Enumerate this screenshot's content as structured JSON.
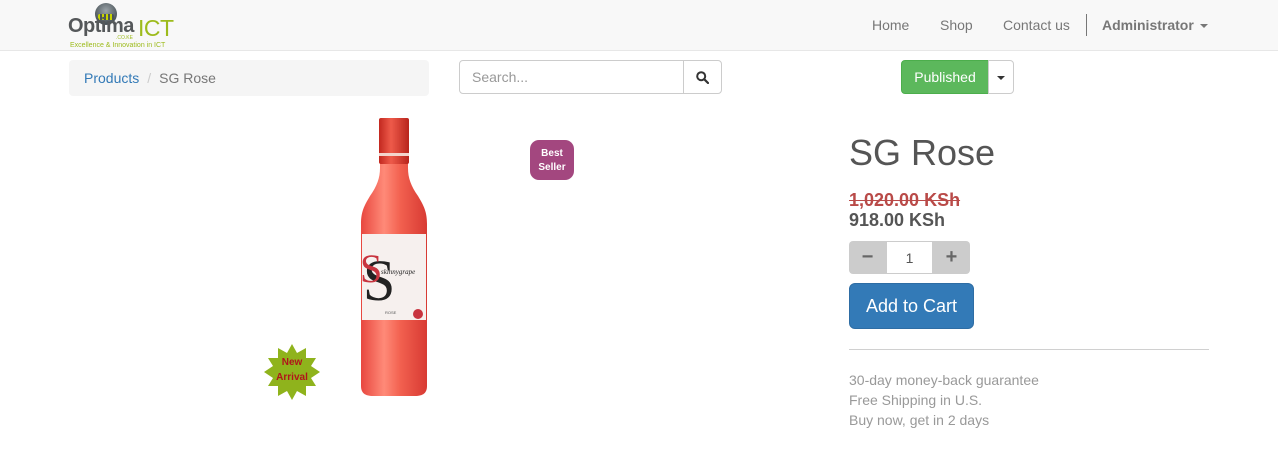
{
  "brand": {
    "name_part1": "Optima",
    "name_part2": "ICT",
    "domain_suffix": ".CO.KE",
    "tagline": "Excellence & Innovation in ICT"
  },
  "nav": {
    "items": [
      {
        "label": "Home"
      },
      {
        "label": "Shop"
      },
      {
        "label": "Contact us"
      }
    ],
    "user": "Administrator"
  },
  "breadcrumb": {
    "parent": "Products",
    "current": "SG Rose"
  },
  "search": {
    "placeholder": "Search...",
    "icon": "search-icon"
  },
  "publish": {
    "label": "Published",
    "color": "#5cb85c"
  },
  "product": {
    "title": "SG Rose",
    "old_price": "1,020.00 KSh",
    "price": "918.00 KSh",
    "quantity": "1",
    "add_to_cart": "Add to Cart",
    "ribbons": {
      "best_seller_line1": "Best",
      "best_seller_line2": "Seller",
      "new_arrival_line1": "New",
      "new_arrival_line2": "Arrival"
    },
    "label_text": {
      "brand": "skinnygrape",
      "variety": "ROSE"
    },
    "benefits": [
      "30-day money-back guarantee",
      "Free Shipping in U.S.",
      "Buy now, get in 2 days"
    ]
  },
  "colors": {
    "accent": "#337ab7",
    "best_seller_badge": "#a3477f",
    "new_arrival_badge": "#8fb31c",
    "old_price": "#b94a48"
  }
}
